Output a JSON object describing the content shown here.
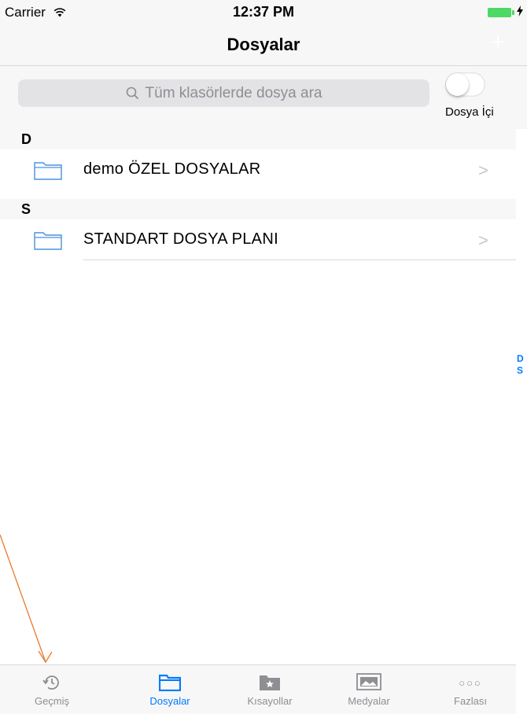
{
  "status_bar": {
    "carrier": "Carrier",
    "time": "12:37 PM",
    "battery_color": "#4cd964",
    "icons": [
      "wifi-icon",
      "battery-icon",
      "charging-bolt-icon"
    ]
  },
  "nav": {
    "title": "Dosyalar",
    "add_label": "+"
  },
  "search": {
    "placeholder": "Tüm klasörlerde dosya ara",
    "toggle_on": false,
    "toggle_label": "Dosya İçi"
  },
  "sections": [
    {
      "letter": "D",
      "folder_name": "demo ÖZEL DOSYALAR",
      "chevron": ">"
    },
    {
      "letter": "S",
      "folder_name": "STANDART DOSYA PLANI",
      "chevron": ">"
    }
  ],
  "section_index": [
    "D",
    "S"
  ],
  "tab_bar": {
    "active_index": 1,
    "tabs": [
      {
        "label": "Geçmiş",
        "icon": "history-icon"
      },
      {
        "label": "Dosyalar",
        "icon": "folder-icon"
      },
      {
        "label": "Kısayollar",
        "icon": "star-folder-icon"
      },
      {
        "label": "Medyalar",
        "icon": "photos-icon"
      },
      {
        "label": "Fazlası",
        "icon": "more-icon",
        "glyph": "○○○"
      }
    ]
  },
  "colors": {
    "accent": "#007aff",
    "inactive": "#8e8e93",
    "annotation_arrow": "#e87a2d",
    "folder_outline": "#4a90e2"
  }
}
